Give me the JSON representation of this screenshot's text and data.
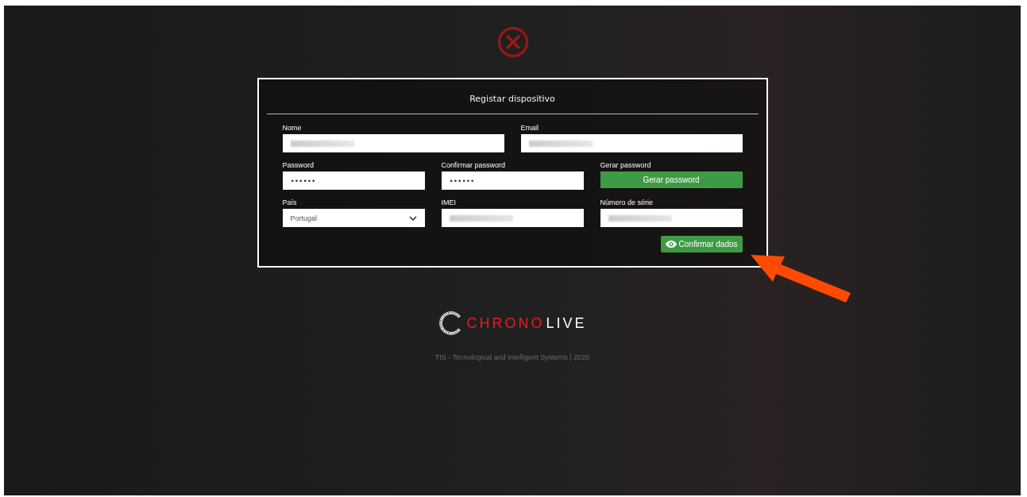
{
  "dialog": {
    "title": "Registar dispositivo",
    "rows": [
      [
        {
          "kind": "text",
          "label": "Nome",
          "blurred": true
        },
        {
          "kind": "text",
          "label": "Email",
          "blurred": true
        }
      ],
      [
        {
          "kind": "password",
          "label": "Password",
          "value": "••••••"
        },
        {
          "kind": "password",
          "label": "Confirmar password",
          "value": "••••••"
        },
        {
          "kind": "button",
          "label": "Gerar password",
          "button": "Gerar password"
        }
      ],
      [
        {
          "kind": "select",
          "label": "País",
          "value": "Portugal"
        },
        {
          "kind": "text",
          "label": "IMEI",
          "blurred": true
        },
        {
          "kind": "text",
          "label": "Número de série",
          "blurred": true
        }
      ]
    ],
    "submit": "Confirmar dados"
  },
  "logo": {
    "part_1": "CHRONO",
    "part_2": "LIVE"
  },
  "footer": "TIS - Tecnological and Intelligent Systems | 2020"
}
